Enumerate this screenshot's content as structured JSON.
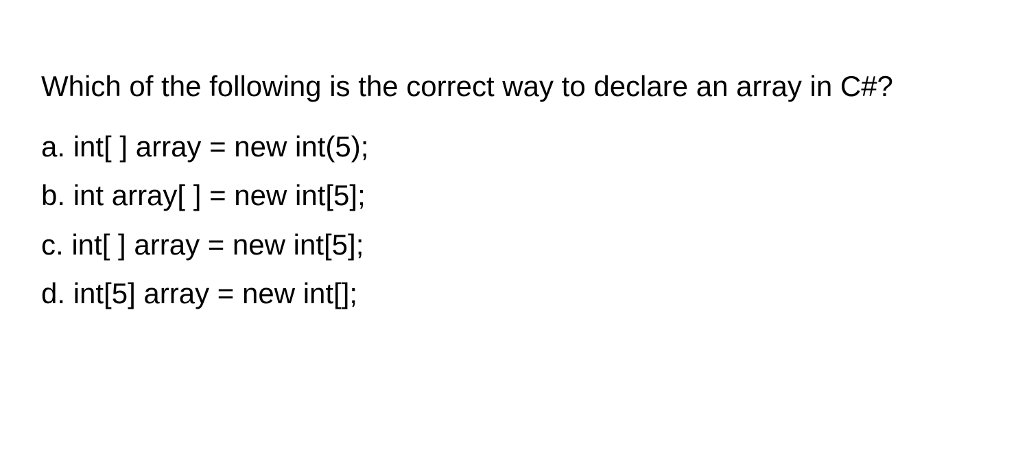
{
  "question": "Which of the following is the correct way to declare an array in C#?",
  "options": [
    {
      "label": "a.",
      "text": "int[ ] array = new int(5);"
    },
    {
      "label": "b.",
      "text": "int array[ ] = new int[5];"
    },
    {
      "label": "c.",
      "text": "int[ ] array = new int[5];"
    },
    {
      "label": "d.",
      "text": "int[5] array = new int[];"
    }
  ]
}
